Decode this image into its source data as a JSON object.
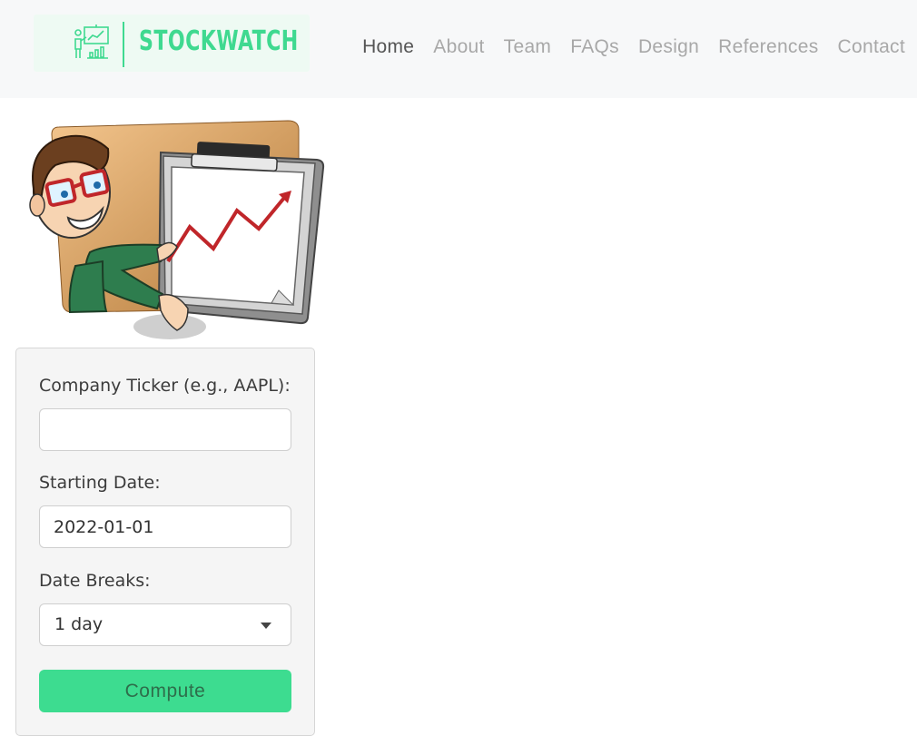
{
  "brand": {
    "name": "STOCKWATCH",
    "icon": "presentation-chart-icon",
    "color": "#3fd990"
  },
  "nav": {
    "items": [
      {
        "label": "Home",
        "active": true
      },
      {
        "label": "About",
        "active": false
      },
      {
        "label": "Team",
        "active": false
      },
      {
        "label": "FAQs",
        "active": false
      },
      {
        "label": "Design",
        "active": false
      },
      {
        "label": "References",
        "active": false
      },
      {
        "label": "Contact",
        "active": false
      }
    ]
  },
  "hero": {
    "image": "cartoon-man-presenting-rising-chart"
  },
  "form": {
    "ticker": {
      "label": "Company Ticker (e.g., AAPL):",
      "value": ""
    },
    "start_date": {
      "label": "Starting Date:",
      "value": "2022-01-01"
    },
    "date_breaks": {
      "label": "Date Breaks:",
      "value": "1 day"
    },
    "submit_label": "Compute",
    "accent_color": "#3ddc90"
  }
}
